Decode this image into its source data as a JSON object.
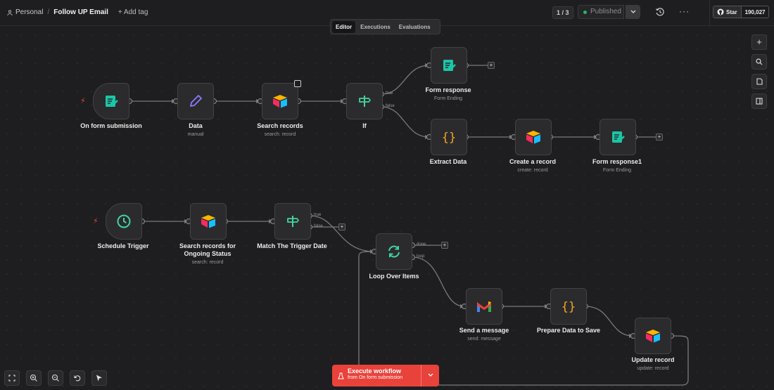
{
  "header": {
    "project": "Personal",
    "workflow_name": "Follow UP Email",
    "add_tag": "+ Add tag",
    "counter": "1 / 3",
    "status": "Published",
    "github_star": "Star",
    "github_count": "190,027"
  },
  "tabs": [
    "Editor",
    "Executions",
    "Evaluations"
  ],
  "nodes": {
    "on_form": {
      "label": "On form submission"
    },
    "data": {
      "label": "Data",
      "sub": "manual"
    },
    "search_records": {
      "label": "Search records",
      "sub": "search: record"
    },
    "if": {
      "label": "If",
      "true": "true",
      "false": "false"
    },
    "form_response": {
      "label": "Form response",
      "sub": "Form Ending"
    },
    "extract_data": {
      "label": "Extract Data"
    },
    "create_record": {
      "label": "Create a record",
      "sub": "create: record"
    },
    "form_response1": {
      "label": "Form response1",
      "sub": "Form Ending"
    },
    "schedule_trigger": {
      "label": "Schedule Trigger"
    },
    "search_ongoing": {
      "label": "Search records for Ongoing Status",
      "sub": "search: record"
    },
    "match_date": {
      "label": "Match The Trigger Date",
      "true": "true",
      "false": "false"
    },
    "loop_items": {
      "label": "Loop Over Items",
      "done": "done",
      "loop": "loop"
    },
    "send_message": {
      "label": "Send a message",
      "sub": "send: message"
    },
    "prepare_data": {
      "label": "Prepare Data to Save"
    },
    "update_record": {
      "label": "Update record",
      "sub": "update: record"
    }
  },
  "execute": {
    "label": "Execute workflow",
    "sub": "from On form submission"
  },
  "colors": {
    "accent_red": "#e9423b",
    "published_dot": "#2db36b",
    "form_teal": "#1bc5a6",
    "data_purple": "#8a7bff",
    "if_green": "#43d39e",
    "code_orange": "#f5a623"
  }
}
